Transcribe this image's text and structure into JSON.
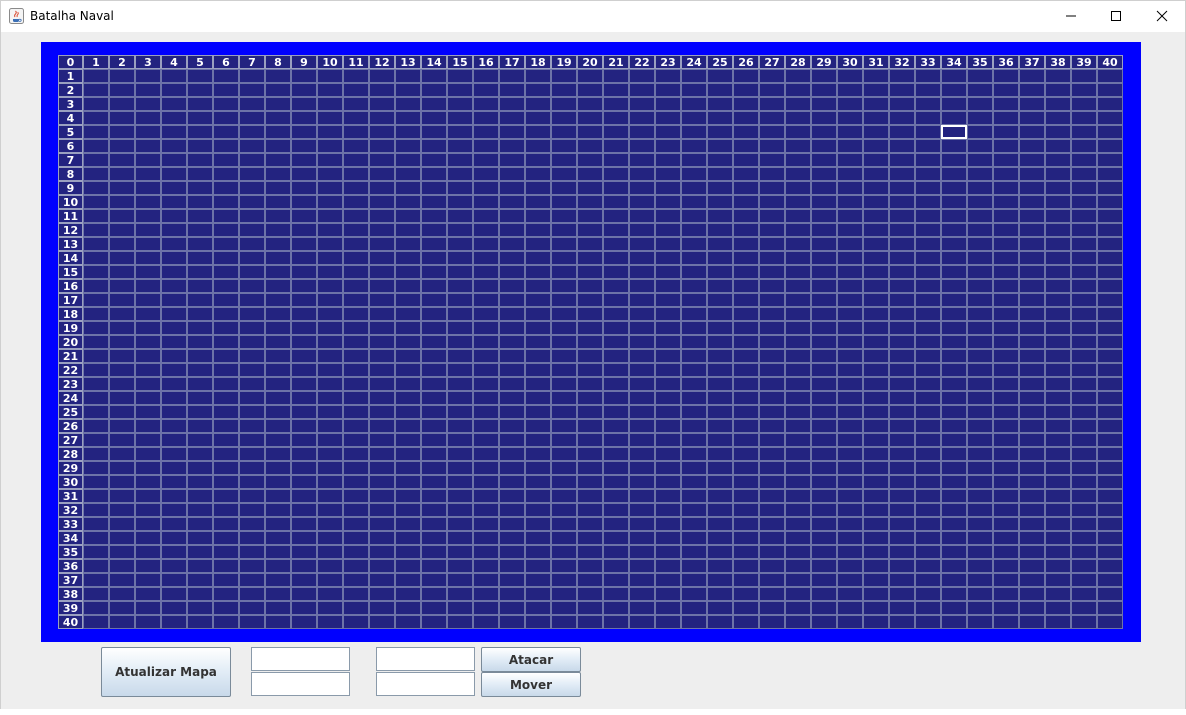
{
  "window": {
    "title": "Batalha Naval",
    "app_icon": "java-coffee-cup-icon",
    "controls": [
      "minimize-icon",
      "maximize-icon",
      "close-icon"
    ]
  },
  "board": {
    "corner_label": "0",
    "columns": [
      "1",
      "2",
      "3",
      "4",
      "5",
      "6",
      "7",
      "8",
      "9",
      "10",
      "11",
      "12",
      "13",
      "14",
      "15",
      "16",
      "17",
      "18",
      "19",
      "20",
      "21",
      "22",
      "23",
      "24",
      "25",
      "26",
      "27",
      "28",
      "29",
      "30",
      "31",
      "32",
      "33",
      "34",
      "35",
      "36",
      "37",
      "38",
      "39",
      "40"
    ],
    "rows": [
      "1",
      "2",
      "3",
      "4",
      "5",
      "6",
      "7",
      "8",
      "9",
      "10",
      "11",
      "12",
      "13",
      "14",
      "15",
      "16",
      "17",
      "18",
      "19",
      "20",
      "21",
      "22",
      "23",
      "24",
      "25",
      "26",
      "27",
      "28",
      "29",
      "30",
      "31",
      "32",
      "33",
      "34",
      "35",
      "36",
      "37",
      "38",
      "39",
      "40"
    ],
    "selected_cell": {
      "row": 5,
      "col": 34
    },
    "colors": {
      "frame": "#0000ff",
      "cell": "#232380",
      "grid_line": "#6d73a8",
      "header_text": "#ffffff"
    }
  },
  "controls": {
    "refresh_map_label": "Atualizar Mapa",
    "attack_label": "Atacar",
    "move_label": "Mover",
    "field_1_value": "",
    "field_2_value": "",
    "field_3_value": "",
    "field_4_value": ""
  }
}
